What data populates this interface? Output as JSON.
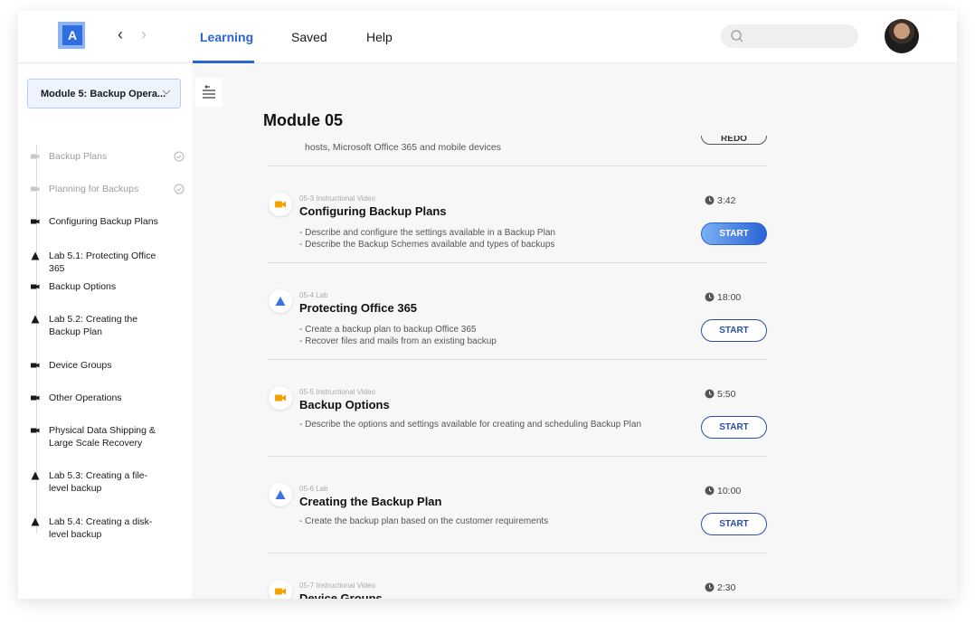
{
  "header": {
    "logo_letter": "A",
    "tabs": [
      {
        "label": "Learning",
        "active": true
      },
      {
        "label": "Saved",
        "active": false
      },
      {
        "label": "Help",
        "active": false
      }
    ],
    "search_placeholder": ""
  },
  "sidebar": {
    "module_select": "Module 5: Backup Opera...",
    "items": [
      {
        "label": "Backup Plans",
        "icon": "video-icon",
        "completed": true
      },
      {
        "label": "Planning for Backups",
        "icon": "video-icon",
        "completed": true
      },
      {
        "label": "Configuring Backup Plans",
        "icon": "video-icon",
        "completed": false
      },
      {
        "label": "Lab 5.1: Protecting Office 365",
        "icon": "lab-flask-icon",
        "completed": false
      },
      {
        "label": "Backup Options",
        "icon": "video-icon",
        "completed": false
      },
      {
        "label": "Lab 5.2: Creating the Backup Plan",
        "icon": "lab-flask-icon",
        "completed": false
      },
      {
        "label": "Device Groups",
        "icon": "video-icon",
        "completed": false
      },
      {
        "label": "Other Operations",
        "icon": "video-icon",
        "completed": false
      },
      {
        "label": "Physical Data Shipping & Large Scale Recovery",
        "icon": "video-icon",
        "completed": false
      },
      {
        "label": "Lab 5.3: Creating a file-level backup",
        "icon": "lab-flask-icon",
        "completed": false
      },
      {
        "label": "Lab 5.4: Creating a disk-level backup",
        "icon": "lab-flask-icon",
        "completed": false
      }
    ]
  },
  "main": {
    "title": "Module 05",
    "partial": {
      "desc": "hosts, Microsoft Office 365 and mobile devices",
      "button": "REDO"
    },
    "cards": [
      {
        "meta": "05-3 Instructional Video",
        "title": "Configuring Backup Plans",
        "desc": [
          "- Describe and configure the settings available in a Backup Plan",
          "- Describe the Backup Schemes available and types of backups"
        ],
        "duration": "3:42",
        "button": "START",
        "type": "video"
      },
      {
        "meta": "05-4 Lab",
        "title": "Protecting Office 365",
        "desc": [
          "- Create a backup plan to backup Office 365",
          "- Recover files and mails from an existing backup"
        ],
        "duration": "18:00",
        "button": "START",
        "type": "lab"
      },
      {
        "meta": "05-5 Instructional Video",
        "title": "Backup Options",
        "desc": [
          "- Describe the options and settings available for creating and scheduling Backup Plan"
        ],
        "duration": "5:50",
        "button": "START",
        "type": "video"
      },
      {
        "meta": "05-6 Lab",
        "title": "Creating the Backup Plan",
        "desc": [
          "- Create the backup plan based on the customer requirements"
        ],
        "duration": "10:00",
        "button": "START",
        "type": "lab"
      },
      {
        "meta": "05-7 Instructional Video",
        "title": "Device Groups",
        "desc": [],
        "duration": "2:30",
        "button": "",
        "type": "video"
      }
    ]
  },
  "colors": {
    "accent": "#2a63d6",
    "video_icon": "#f5a200",
    "lab_icon": "#3b74e0"
  }
}
